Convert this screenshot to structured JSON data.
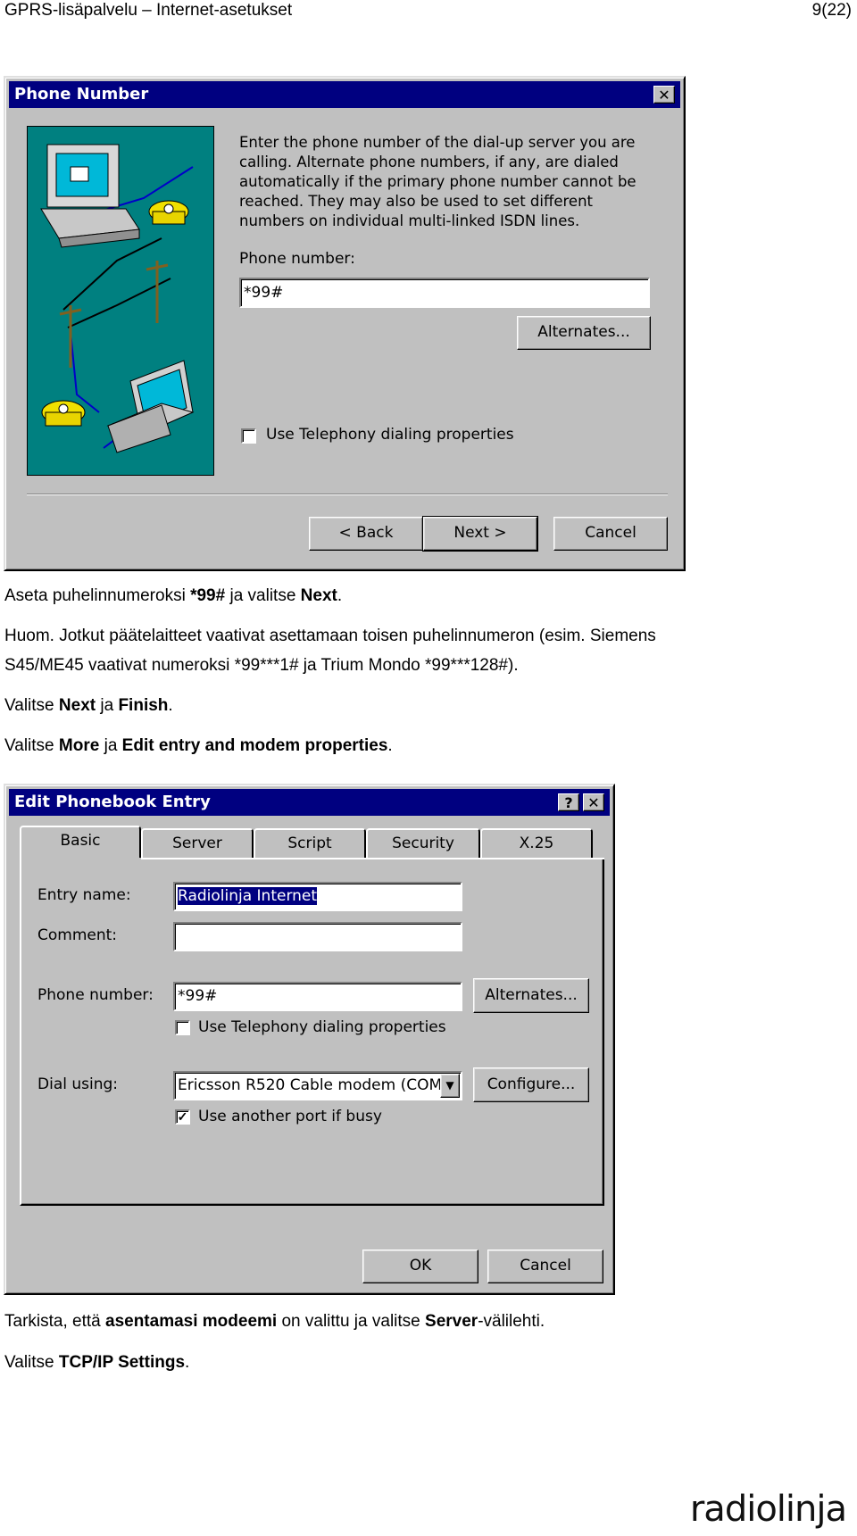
{
  "header": {
    "title": "GPRS-lisäpalvelu – Internet-asetukset",
    "page": "9(22)"
  },
  "dialog1": {
    "title": "Phone Number",
    "close": "✕",
    "intro_lines": [
      "Enter the phone number of the dial-up server you are",
      "calling.  Alternate phone numbers, if any, are dialed",
      "automatically if the primary phone number cannot be",
      "reached.  They may also be used to set different",
      "numbers on individual multi-linked ISDN lines."
    ],
    "phone_label": "Phone number:",
    "phone_value": "*99#",
    "alternates": "Alternates...",
    "telephony_label": "Use Telephony dialing properties",
    "back": "< Back",
    "next": "Next >",
    "cancel": "Cancel"
  },
  "text1": {
    "p1_a": "Aseta puhelinnumeroksi ",
    "p1_b": "*99#",
    "p1_c": " ja valitse ",
    "p1_d": "Next",
    "p1_e": ".",
    "p2_line1": "Huom. Jotkut päätelaitteet vaativat asettamaan toisen puhelinnumeron (esim. Siemens",
    "p2_line2": "S45/ME45 vaativat numeroksi *99***1# ja Trium Mondo *99***128#).",
    "p3_a": "Valitse ",
    "p3_b": "Next",
    "p3_c": " ja ",
    "p3_d": "Finish",
    "p3_e": ".",
    "p4_a": "Valitse ",
    "p4_b": "More",
    "p4_c": " ja ",
    "p4_d": "Edit entry and modem properties",
    "p4_e": "."
  },
  "dialog2": {
    "title": "Edit Phonebook Entry",
    "help": "?",
    "close": "✕",
    "tabs": [
      "Basic",
      "Server",
      "Script",
      "Security",
      "X.25"
    ],
    "entry_label": "Entry name:",
    "entry_value": "Radiolinja Internet",
    "comment_label": "Comment:",
    "comment_value": "",
    "phone_label": "Phone number:",
    "phone_value": "*99#",
    "alternates": "Alternates...",
    "telephony_label": "Use Telephony dialing properties",
    "dial_label": "Dial using:",
    "dial_value": "Ericsson R520 Cable modem (COM",
    "configure": "Configure...",
    "another_port_label": "Use another port if busy",
    "another_port_checked": "✓",
    "ok": "OK",
    "cancel": "Cancel"
  },
  "text2": {
    "p5_a": "Tarkista, että ",
    "p5_b": "asentamasi modeemi",
    "p5_c": " on valittu ja valitse ",
    "p5_d": "Server",
    "p5_e": "-välilehti.",
    "p6_a": "Valitse ",
    "p6_b": "TCP/IP Settings",
    "p6_c": "."
  },
  "footer": {
    "logo": "radiolinja"
  }
}
